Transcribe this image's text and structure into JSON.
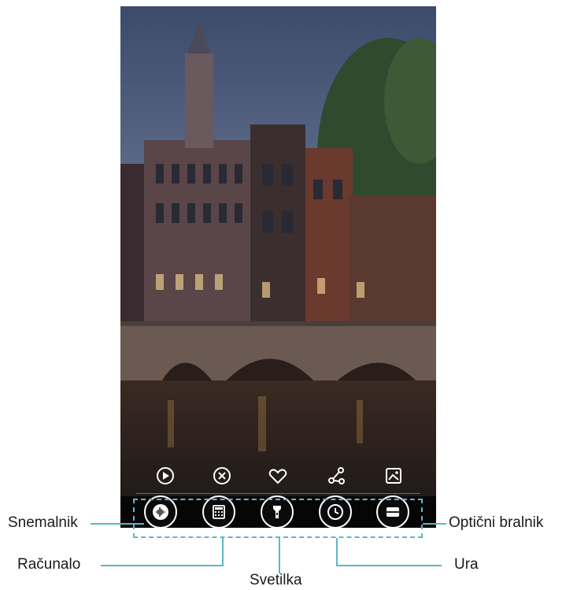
{
  "action_bar": {
    "icons": [
      "play-icon",
      "close-circle-icon",
      "heart-icon",
      "share-icon",
      "image-icon"
    ]
  },
  "toolbar": {
    "tools": [
      {
        "icon": "audio-wave-icon",
        "callout": "Snemalnik"
      },
      {
        "icon": "calculator-icon",
        "callout": "Računalo"
      },
      {
        "icon": "flashlight-icon",
        "callout": "Svetilka"
      },
      {
        "icon": "clock-icon",
        "callout": "Ura"
      },
      {
        "icon": "scanner-icon",
        "callout": "Optični bralnik"
      }
    ]
  },
  "colors": {
    "callout_line": "#5bb8c9",
    "toolbar_bg": "#000000",
    "icon": "#ffffff"
  }
}
